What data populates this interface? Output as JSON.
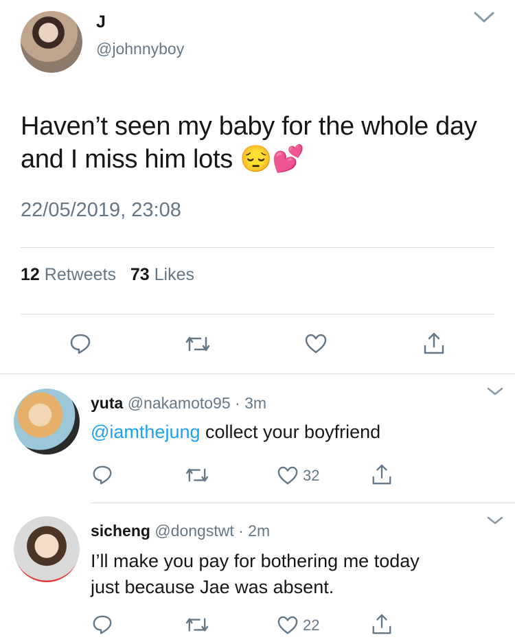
{
  "main_tweet": {
    "display_name": "J",
    "handle": "@johnnyboy",
    "text": "Haven’t seen my baby for the whole day and I miss him lots 😔💕",
    "timestamp": "22/05/2019, 23:08",
    "retweets_count": "12",
    "retweets_label": "Retweets",
    "likes_count": "73",
    "likes_label": "Likes",
    "actions": [
      "reply-icon",
      "retweet-icon",
      "like-icon",
      "share-icon"
    ]
  },
  "replies": [
    {
      "display_name": "yuta",
      "handle": "@nakamoto95",
      "separator": "·",
      "time": "3m",
      "mention": "@iamthejung",
      "text": " collect your boyfriend",
      "like_count": "32"
    },
    {
      "display_name": "sicheng",
      "handle": "@dongstwt",
      "separator": "·",
      "time": "2m",
      "text_line1": "I’ll make you pay for bothering me today",
      "text_line2": "just because Jae was absent.",
      "like_count": "22"
    }
  ],
  "colors": {
    "text": "#14171a",
    "muted": "#657786",
    "link": "#1da1f2",
    "divider": "#d8dde1"
  }
}
